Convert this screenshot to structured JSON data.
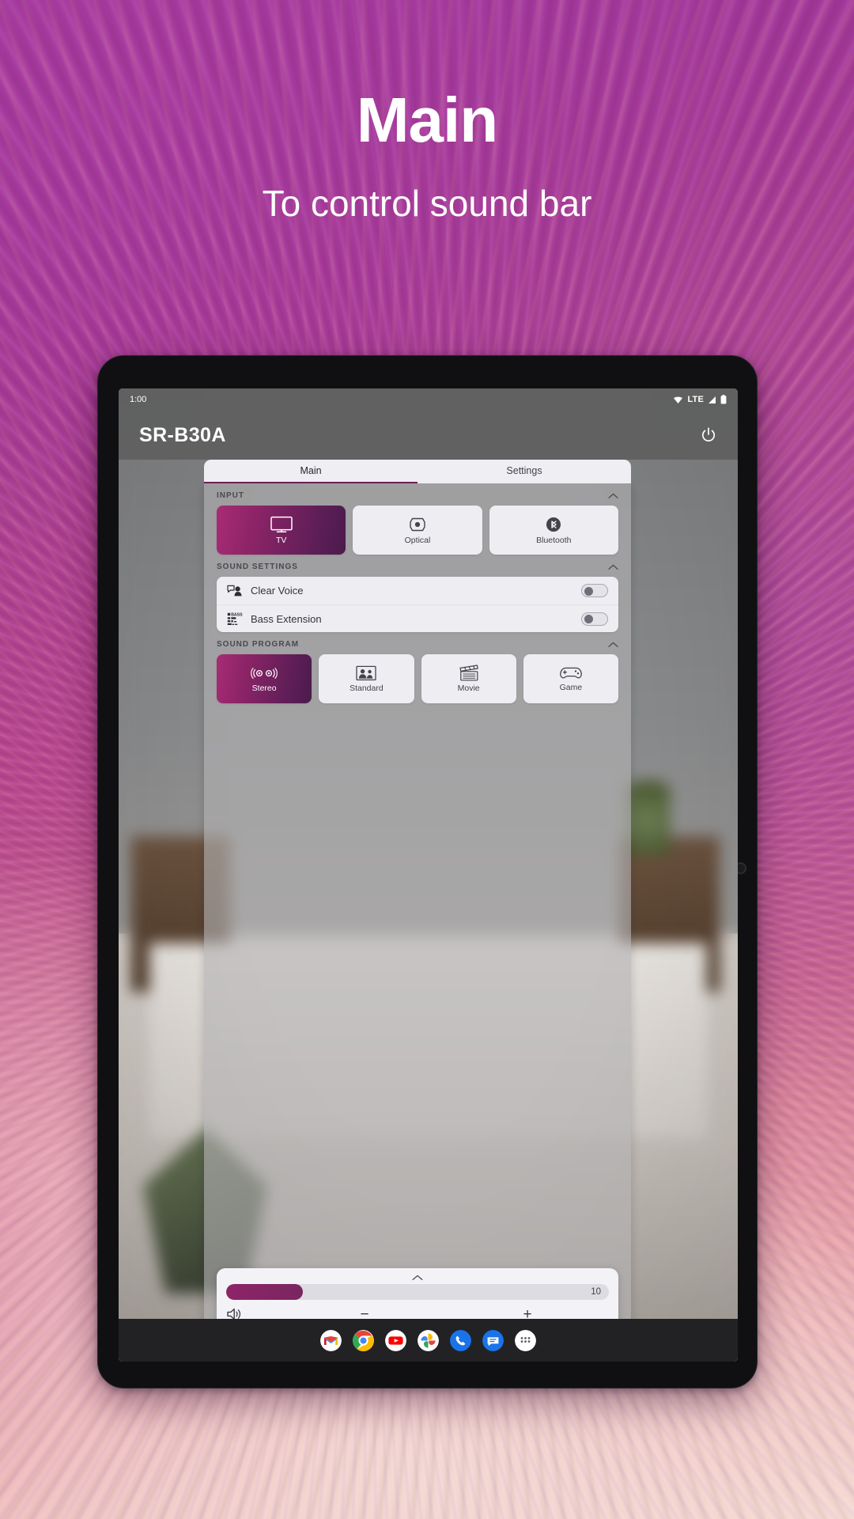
{
  "promo": {
    "title": "Main",
    "subtitle": "To control sound bar"
  },
  "status_bar": {
    "time": "1:00",
    "network_label": "LTE",
    "icons": [
      "wifi-icon",
      "signal-icon",
      "battery-icon"
    ]
  },
  "app": {
    "device_name": "SR-B30A",
    "power_icon": "power-icon",
    "tabs": [
      {
        "label": "Main",
        "active": true
      },
      {
        "label": "Settings",
        "active": false
      }
    ],
    "sections": {
      "input": {
        "title": "INPUT",
        "collapse_icon": "chevron-up-icon",
        "options": [
          {
            "label": "TV",
            "icon": "tv-icon",
            "selected": true
          },
          {
            "label": "Optical",
            "icon": "optical-icon",
            "selected": false
          },
          {
            "label": "Bluetooth",
            "icon": "bluetooth-icon",
            "selected": false
          }
        ]
      },
      "sound_settings": {
        "title": "SOUND SETTINGS",
        "collapse_icon": "chevron-up-icon",
        "rows": [
          {
            "label": "Clear Voice",
            "icon": "clear-voice-icon",
            "enabled": false
          },
          {
            "label": "Bass Extension",
            "icon": "bass-extension-icon",
            "enabled": false
          }
        ]
      },
      "sound_program": {
        "title": "SOUND PROGRAM",
        "collapse_icon": "chevron-up-icon",
        "options": [
          {
            "label": "Stereo",
            "icon": "stereo-icon",
            "selected": true
          },
          {
            "label": "Standard",
            "icon": "standard-icon",
            "selected": false
          },
          {
            "label": "Movie",
            "icon": "movie-icon",
            "selected": false
          },
          {
            "label": "Game",
            "icon": "game-icon",
            "selected": false
          }
        ]
      }
    },
    "volume": {
      "expand_icon": "chevron-up-icon",
      "value": "10",
      "percent": 20,
      "speaker_icon": "speaker-icon",
      "decrease_label": "−",
      "increase_label": "+"
    }
  },
  "dock": {
    "icons": [
      "gmail-icon",
      "chrome-icon",
      "youtube-icon",
      "photos-icon",
      "phone-icon",
      "messages-icon",
      "app-drawer-icon"
    ]
  },
  "colors": {
    "accent_purple": "#8e2468",
    "accent_dark_purple": "#4b1b4d",
    "tab_underline": "#6e1f55",
    "panel_light": "#eeedf2",
    "promo_text": "#ffffff"
  }
}
